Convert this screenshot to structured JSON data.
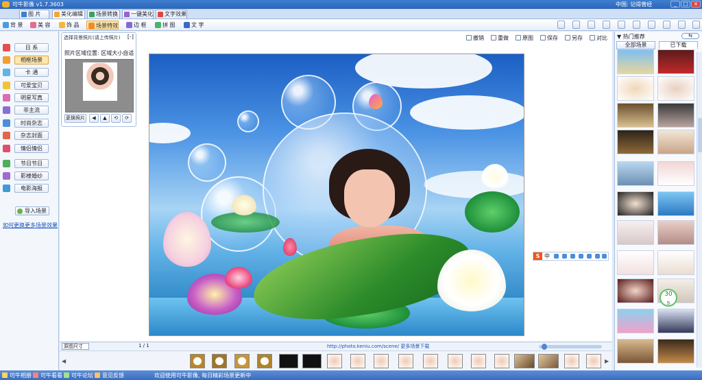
{
  "titlebar": {
    "title": "可牛影像 v1.7.3603",
    "user": "中国: 记得曾经",
    "min": "_",
    "max": "□",
    "close": "×"
  },
  "tabs": [
    {
      "label": "图 片",
      "icon": "picture-icon",
      "color": "#3f7fd0"
    },
    {
      "label": "美化编辑",
      "icon": "edit-icon",
      "color": "#f4a535"
    },
    {
      "label": "场景转换",
      "icon": "scene-icon",
      "color": "#39a35c"
    },
    {
      "label": "一键美化",
      "icon": "wand-icon",
      "color": "#9b5fcf"
    },
    {
      "label": "文字效果",
      "icon": "text-icon",
      "color": "#e2453a"
    }
  ],
  "toolbar": [
    {
      "label": "背 景",
      "icon": "background-icon",
      "color": "#4b9be0"
    },
    {
      "label": "美 容",
      "icon": "beauty-icon",
      "color": "#e46d8c"
    },
    {
      "label": "饰 品",
      "icon": "accessory-icon",
      "color": "#f0b93b"
    },
    {
      "label": "场景特效",
      "icon": "scene-effect-icon",
      "color": "#f18a2c"
    },
    {
      "label": "边 框",
      "icon": "border-icon",
      "color": "#7e6bd6"
    },
    {
      "label": "拼 图",
      "icon": "puzzle-icon",
      "color": "#4ab36b"
    },
    {
      "label": "文 字",
      "icon": "text-tool-icon",
      "color": "#3b69c4"
    }
  ],
  "left_menu": [
    {
      "label": "日 系",
      "icon": "japan-icon",
      "color": "#e44e4e"
    },
    {
      "label": "相框场景",
      "icon": "frame-scene-icon",
      "color": "#f0a030"
    },
    {
      "label": "卡 通",
      "icon": "cartoon-icon",
      "color": "#5fb4e8"
    },
    {
      "label": "可爱宝贝",
      "icon": "baby-icon",
      "color": "#f1c23a"
    },
    {
      "label": "明星写真",
      "icon": "star-icon",
      "color": "#d86fb1"
    },
    {
      "label": "非主流",
      "icon": "trend-icon",
      "color": "#8a6fd6"
    },
    {
      "label": "时尚杂志",
      "icon": "magazine-icon",
      "color": "#4c8fd8"
    },
    {
      "label": "杂志封面",
      "icon": "cover-icon",
      "color": "#e06848"
    },
    {
      "label": "情侣情侣",
      "icon": "couple-icon",
      "color": "#e34d6d"
    },
    {
      "label": "节日节日",
      "icon": "holiday-icon",
      "color": "#4cae5c"
    },
    {
      "label": "影楼婚纱",
      "icon": "wedding-icon",
      "color": "#a06ad0"
    },
    {
      "label": "电影海报",
      "icon": "movie-icon",
      "color": "#3e9ad7"
    }
  ],
  "left_actions": {
    "add_scene": "导入场景",
    "more_link": "如何更换更多场景效果"
  },
  "photo_panel": {
    "title": "选择背景照片(请上传照片)",
    "close": "[-]",
    "hint": "照片区域位置: 区域大小自适",
    "open": "更换照片",
    "controls": [
      "◀",
      "▲",
      "⟲",
      "⟳"
    ]
  },
  "edit_tools": [
    {
      "label": "撤销",
      "icon": "undo-icon"
    },
    {
      "label": "重做",
      "icon": "redo-icon"
    },
    {
      "label": "原图",
      "icon": "original-icon"
    },
    {
      "label": "保存",
      "icon": "save-icon"
    },
    {
      "label": "另存",
      "icon": "save-as-icon"
    },
    {
      "label": "对比",
      "icon": "compare-icon"
    }
  ],
  "right_panel": {
    "header": "▼ 热门推荐",
    "toggle": "⇆",
    "tabs": [
      "全部场景",
      "已下载"
    ],
    "badge_value": "30",
    "badge_unit": "s"
  },
  "ime": {
    "s": "S",
    "zh": "中"
  },
  "bottom": {
    "ratio": "原图尺寸",
    "page": "1 / 1",
    "url": "http://photo.keniu.com/scene/ 更多场景下载"
  },
  "strip": {
    "left_arrow": "◀",
    "right_arrow": "▶"
  },
  "statusbar": {
    "items": [
      {
        "label": "可牛相册",
        "icon": "album-icon",
        "color": "#ffd35a"
      },
      {
        "label": "可牛看看",
        "icon": "view-icon",
        "color": "#ff7f7f"
      },
      {
        "label": "可牛论坛",
        "icon": "forum-icon",
        "color": "#9fe38b"
      },
      {
        "label": "意见反馈",
        "icon": "feedback-icon",
        "color": "#ffc06a"
      }
    ],
    "text": "欢迎使用可牛影像, 每日精彩场景更新中"
  },
  "colors": {
    "accent": "#3a6cc0",
    "highlight": "#ffe6a6"
  }
}
